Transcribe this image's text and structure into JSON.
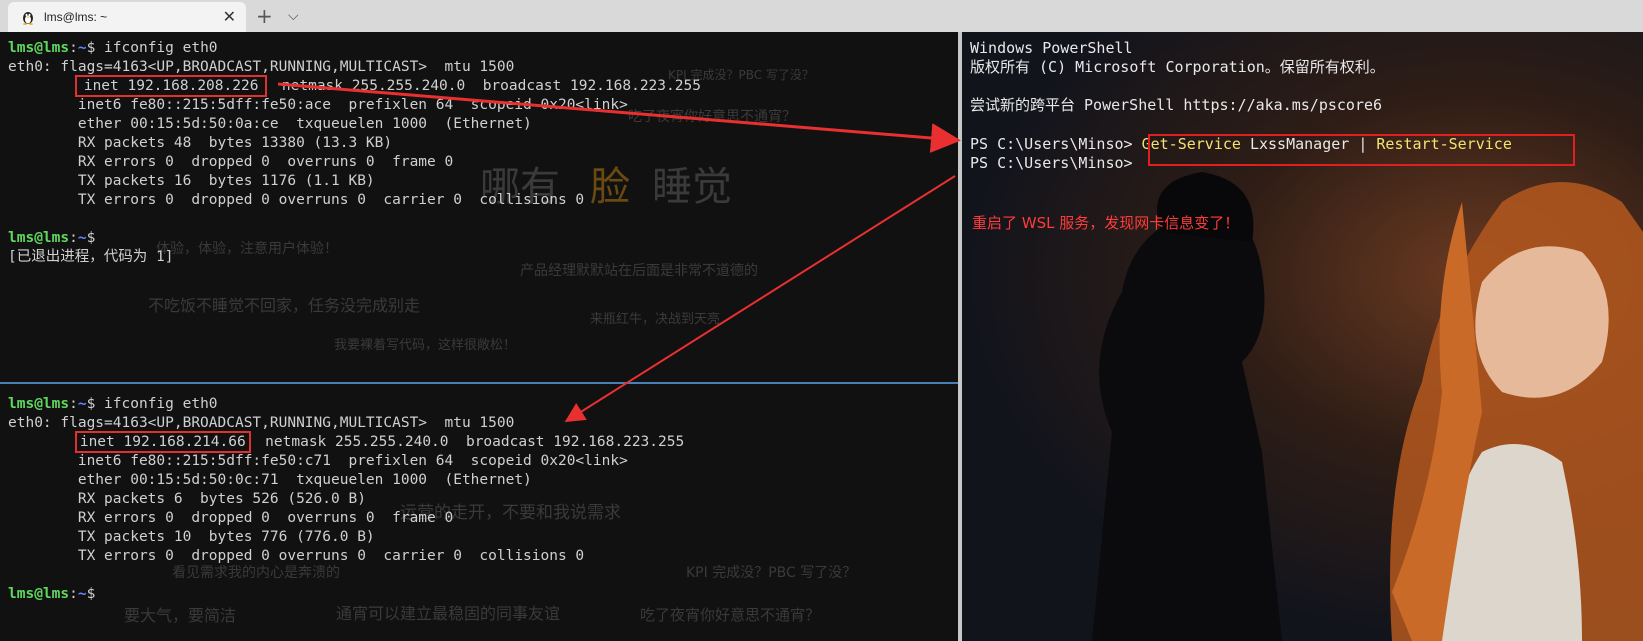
{
  "tab": {
    "title": "lms@lms: ~",
    "new_tab": "+",
    "dropdown": "⌵",
    "close": "✕"
  },
  "prompt": {
    "user": "lms@lms",
    "sep": ":",
    "path": "~",
    "sym": "$"
  },
  "top_pane": {
    "command": " ifconfig eth0",
    "lines": [
      "eth0: flags=4163<UP,BROADCAST,RUNNING,MULTICAST>  mtu 1500",
      "inet 192.168.208.226",
      "  netmask 255.255.240.0  broadcast 192.168.223.255",
      "        inet6 fe80::215:5dff:fe50:ace  prefixlen 64  scopeid 0x20<link>",
      "        ether 00:15:5d:50:0a:ce  txqueuelen 1000  (Ethernet)",
      "        RX packets 48  bytes 13380 (13.3 KB)",
      "        RX errors 0  dropped 0  overruns 0  frame 0",
      "        TX packets 16  bytes 1176 (1.1 KB)",
      "        TX errors 0  dropped 0 overruns 0  carrier 0  collisions 0"
    ],
    "exit_msg": "[已退出进程，代码为 1]"
  },
  "bottom_pane": {
    "command": " ifconfig eth0",
    "lines": [
      "eth0: flags=4163<UP,BROADCAST,RUNNING,MULTICAST>  mtu 1500",
      "inet 192.168.214.66",
      "  netmask 255.255.240.0  broadcast 192.168.223.255",
      "        inet6 fe80::215:5dff:fe50:c71  prefixlen 64  scopeid 0x20<link>",
      "        ether 00:15:5d:50:0c:71  txqueuelen 1000  (Ethernet)",
      "        RX packets 6  bytes 526 (526.0 B)",
      "        RX errors 0  dropped 0  overruns 0  frame 0",
      "        TX packets 10  bytes 776 (776.0 B)",
      "        TX errors 0  dropped 0 overruns 0  carrier 0  collisions 0"
    ]
  },
  "wallpaper_text": {
    "t1": "KPI 完成没？PBC 写了没？",
    "t2": "吃了夜宵你好意思不通宵？",
    "t3": "哪有",
    "t4": "脸",
    "t5": "睡觉",
    "t6": "体验，体验，注意用户体验！",
    "t7": "产品经理默默站在后面是非常不道德的",
    "t8": "不吃饭不睡觉不回家，任务没完成别走",
    "t9": "来瓶红牛，决战到天亮",
    "t10": "我要裸着写代码，这样很敞松！",
    "t11": "运营的走开，不要和我说需求",
    "t12": "看见需求我的内心是奔溃的",
    "t13": "KPI 完成没？PBC 写了没？",
    "t14": "要大气，要简洁",
    "t15": "通宵可以建立最稳固的同事友谊",
    "t16": "吃了夜宵你好意思不通宵？"
  },
  "powershell": {
    "title_line": "Windows PowerShell",
    "copyright": "版权所有 (C) Microsoft Corporation。保留所有权利。",
    "try_line": "尝试新的跨平台 PowerShell https://aka.ms/pscore6",
    "prompt1": "PS C:\\Users\\Minso> ",
    "cmd_part1": "Get-Service",
    "cmd_part2": " LxssManager | ",
    "cmd_part3": "Restart-Service",
    "prompt2": "PS C:\\Users\\Minso>",
    "note": "重启了 WSL 服务，发现网卡信息变了！"
  },
  "colors": {
    "highlight": "#e03030",
    "prompt_user": "#5fd75f",
    "prompt_path": "#5f87ff",
    "ps_cmd": "#f5e36e"
  }
}
